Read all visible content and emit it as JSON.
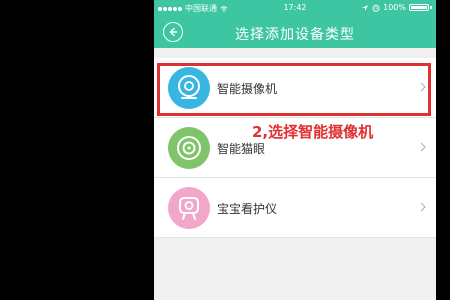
{
  "status_bar": {
    "carrier": "中国联通",
    "time": "17:42",
    "battery": "100%"
  },
  "nav": {
    "title": "选择添加设备类型",
    "back_icon": "back-arrow-icon"
  },
  "items": [
    {
      "label": "智能摄像机",
      "icon": "camera-icon",
      "color": "#36b6e0"
    },
    {
      "label": "智能猫眼",
      "icon": "peephole-icon",
      "color": "#7fc46a"
    },
    {
      "label": "宝宝看护仪",
      "icon": "baby-monitor-icon",
      "color": "#f2a6c9"
    }
  ],
  "annotation": {
    "text": "2,选择智能摄像机"
  },
  "colors": {
    "accent": "#3ec6a2",
    "highlight": "#e03131"
  }
}
